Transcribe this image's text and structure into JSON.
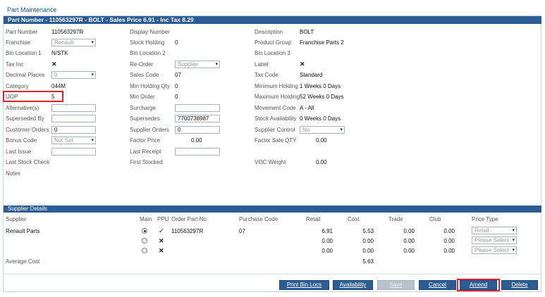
{
  "window_title": "Part Maintenance",
  "title_bar": "Part Number - 110563297R - BOLT - Sales Price 6.91 - Inc Tax 8.29",
  "fields": {
    "part_number_label": "Part Number",
    "part_number": "110563297R",
    "display_number_label": "Display Number",
    "description_label": "Description",
    "description": "BOLT",
    "franchise_label": "Franchise",
    "franchise": "Renault",
    "stock_holding_label": "Stock Holding",
    "stock_holding": "0",
    "product_group_label": "Product Group",
    "product_group": "Franchise Parts 2",
    "bin1_label": "Bin Location 1",
    "bin1": "N/STK",
    "bin2_label": "Bin Location 2",
    "bin3_label": "Bin Location 3",
    "tax_inc_label": "Tax Inc",
    "reorder_label": "Re-Order",
    "reorder": "Supplier",
    "label_label": "Label",
    "decimal_places_label": "Decimal Places",
    "decimal_places": "0",
    "sales_code_label": "Sales Code",
    "sales_code": "07",
    "tax_code_label": "Tax Code",
    "tax_code": "Standard",
    "category_label": "Category",
    "category": "044M",
    "min_holding_qty_label": "Min Holding Qty",
    "min_holding_qty": "0",
    "minimum_holding_label": "Minimum Holding",
    "minimum_holding": "1 Weeks 0 Days",
    "uop_label": "UOP",
    "uop": "5",
    "min_order_label": "Min Order",
    "min_order": "0",
    "maximum_holding_label": "Maximum Holding",
    "maximum_holding": "52 Weeks 0 Days",
    "alternatives_label": "Alternative(s)",
    "surcharge_label": "Surcharge",
    "movement_code_label": "Movement Code",
    "movement_code": "A - All",
    "superseded_by_label": "Superseded By",
    "supersedes_label": "Supersedes",
    "supersedes": "7700738987",
    "stock_availability_label": "Stock Availability",
    "stock_availability": "0 Weeks 0 Days",
    "customer_orders_label": "Customer Orders",
    "customer_orders": "0",
    "supplier_orders_label": "Supplier Orders",
    "supplier_orders": "0",
    "supplier_control_label": "Supplier Control",
    "supplier_control": "No",
    "bonus_code_label": "Bonus Code",
    "bonus_code": "Not Set",
    "factor_price_label": "Factor Price",
    "factor_price": "0.00",
    "factor_sale_qty_label": "Factor Sale QTY",
    "factor_sale_qty": "0.00",
    "last_issue_label": "Last Issue",
    "last_receipt_label": "Last Receipt",
    "last_stock_check_label": "Last Stock Check",
    "first_stocked_label": "First Stocked",
    "voc_weight_label": "VOC Weight",
    "voc_weight": "0.00",
    "notes_label": "Notes"
  },
  "supplier_details": {
    "section_title": "Supplier Details",
    "headers": {
      "supplier": "Supplier",
      "main": "Main",
      "ppu": "PPU",
      "order_part_no": "Order Part No",
      "purchase_code": "Purchase Code",
      "retail": "Retail",
      "cost": "Cost",
      "trade": "Trade",
      "club": "Club",
      "price_type": "Price Type"
    },
    "rows": [
      {
        "supplier": "Renault Parts",
        "order_part_no": "110563297R",
        "purchase_code": "07",
        "retail": "6.91",
        "cost": "5.53",
        "trade": "0.00",
        "club": "0.00",
        "price_type": "Retail -"
      },
      {
        "supplier": "",
        "order_part_no": "",
        "purchase_code": "",
        "retail": "0.00",
        "cost": "0.00",
        "trade": "0.00",
        "club": "0.00",
        "price_type": "Please Select"
      },
      {
        "supplier": "",
        "order_part_no": "",
        "purchase_code": "",
        "retail": "0.00",
        "cost": "0.00",
        "trade": "0.00",
        "club": "0.00",
        "price_type": "Please Select"
      }
    ],
    "average_cost_label": "Average Cost",
    "average_cost": "5.63"
  },
  "buttons": {
    "print_bin_locs": "Print Bin Locs",
    "availability": "Availability",
    "save": "Save",
    "cancel": "Cancel",
    "amend": "Amend",
    "delete": "Delete"
  },
  "icons": {
    "cross": "✕",
    "check": "✓",
    "chevron": "▾"
  },
  "colors": {
    "accent": "#2b5d94",
    "highlight": "#e0202a",
    "disabled": "#b8c2cc"
  }
}
